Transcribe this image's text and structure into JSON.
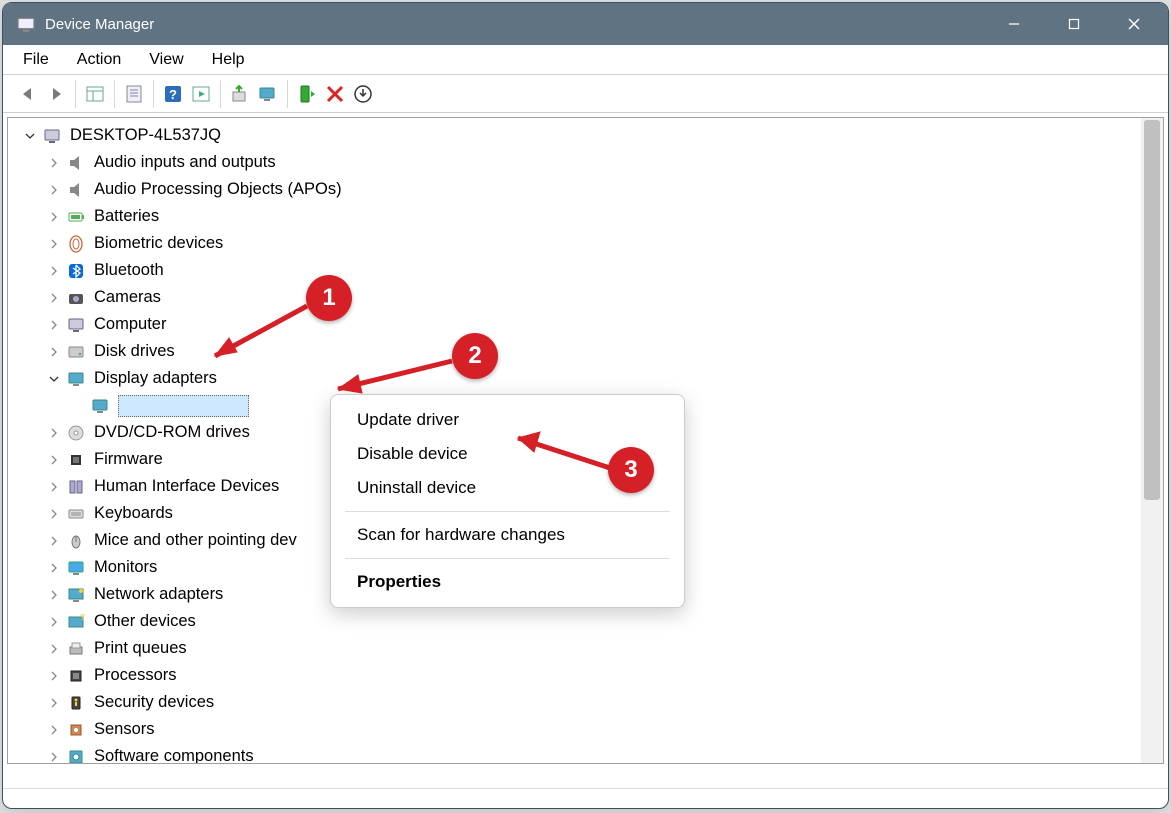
{
  "window": {
    "title": "Device Manager"
  },
  "menubar": [
    "File",
    "Action",
    "View",
    "Help"
  ],
  "tree": {
    "root": "DESKTOP-4L537JQ",
    "nodes": [
      {
        "label": "Audio inputs and outputs",
        "expanded": false,
        "icon": "speaker"
      },
      {
        "label": "Audio Processing Objects (APOs)",
        "expanded": false,
        "icon": "speaker"
      },
      {
        "label": "Batteries",
        "expanded": false,
        "icon": "battery"
      },
      {
        "label": "Biometric devices",
        "expanded": false,
        "icon": "finger"
      },
      {
        "label": "Bluetooth",
        "expanded": false,
        "icon": "bluetooth"
      },
      {
        "label": "Cameras",
        "expanded": false,
        "icon": "camera"
      },
      {
        "label": "Computer",
        "expanded": false,
        "icon": "computer"
      },
      {
        "label": "Disk drives",
        "expanded": false,
        "icon": "disk"
      },
      {
        "label": "Display adapters",
        "expanded": true,
        "icon": "display",
        "children": [
          {
            "label": "",
            "icon": "display",
            "selected": true
          }
        ]
      },
      {
        "label": "DVD/CD-ROM drives",
        "expanded": false,
        "icon": "cdrom"
      },
      {
        "label": "Firmware",
        "expanded": false,
        "icon": "chip"
      },
      {
        "label": "Human Interface Devices",
        "expanded": false,
        "icon": "hid"
      },
      {
        "label": "Keyboards",
        "expanded": false,
        "icon": "keyboard"
      },
      {
        "label": "Mice and other pointing devices",
        "expanded": false,
        "icon": "mouse",
        "truncated": "Mice and other pointing dev"
      },
      {
        "label": "Monitors",
        "expanded": false,
        "icon": "monitor"
      },
      {
        "label": "Network adapters",
        "expanded": false,
        "icon": "network"
      },
      {
        "label": "Other devices",
        "expanded": false,
        "icon": "other"
      },
      {
        "label": "Print queues",
        "expanded": false,
        "icon": "printer"
      },
      {
        "label": "Processors",
        "expanded": false,
        "icon": "cpu"
      },
      {
        "label": "Security devices",
        "expanded": false,
        "icon": "security"
      },
      {
        "label": "Sensors",
        "expanded": false,
        "icon": "sensor"
      },
      {
        "label": "Software components",
        "expanded": false,
        "icon": "software"
      }
    ]
  },
  "context_menu": {
    "items": [
      {
        "label": "Update driver"
      },
      {
        "label": "Disable device"
      },
      {
        "label": "Uninstall device"
      },
      {
        "sep": true
      },
      {
        "label": "Scan for hardware changes"
      },
      {
        "sep": true
      },
      {
        "label": "Properties",
        "bold": true
      }
    ]
  },
  "annotations": {
    "b1": "1",
    "b2": "2",
    "b3": "3"
  }
}
